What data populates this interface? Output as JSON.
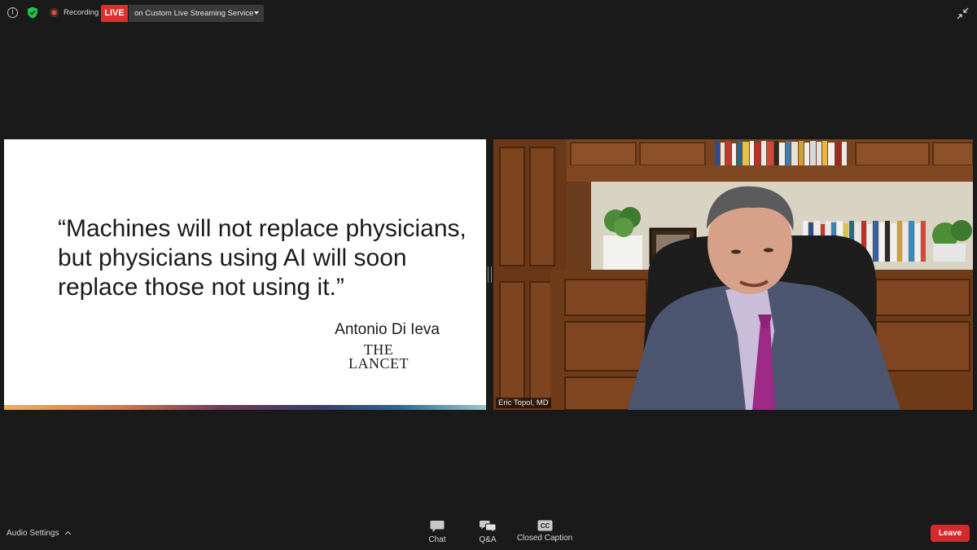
{
  "top_bar": {
    "info_icon": "info-icon",
    "shield_icon": "shield-check-icon",
    "recording_label": "Recording",
    "live_label": "LIVE",
    "stream_target": "on Custom Live Streaming Service",
    "exit_fullscreen_icon": "exit-fullscreen-icon"
  },
  "slide": {
    "quote_lines": [
      "“Machines will not replace physicians,",
      "but physicians using AI will soon",
      "replace those not using it.”"
    ],
    "attribution": "Antonio Di Ieva",
    "publication_line1": "THE",
    "publication_line2": "LANCET"
  },
  "video": {
    "participant_name": "Eric Topol, MD"
  },
  "bottom_bar": {
    "audio_settings": "Audio Settings",
    "chat": "Chat",
    "qa": "Q&A",
    "closed_caption": "Closed Caption",
    "cc_icon_text": "CC",
    "leave": "Leave"
  },
  "colors": {
    "background": "#1a1a1a",
    "live_red": "#e02d2d",
    "leave_red": "#d6292c",
    "shield_green": "#23c04a"
  }
}
